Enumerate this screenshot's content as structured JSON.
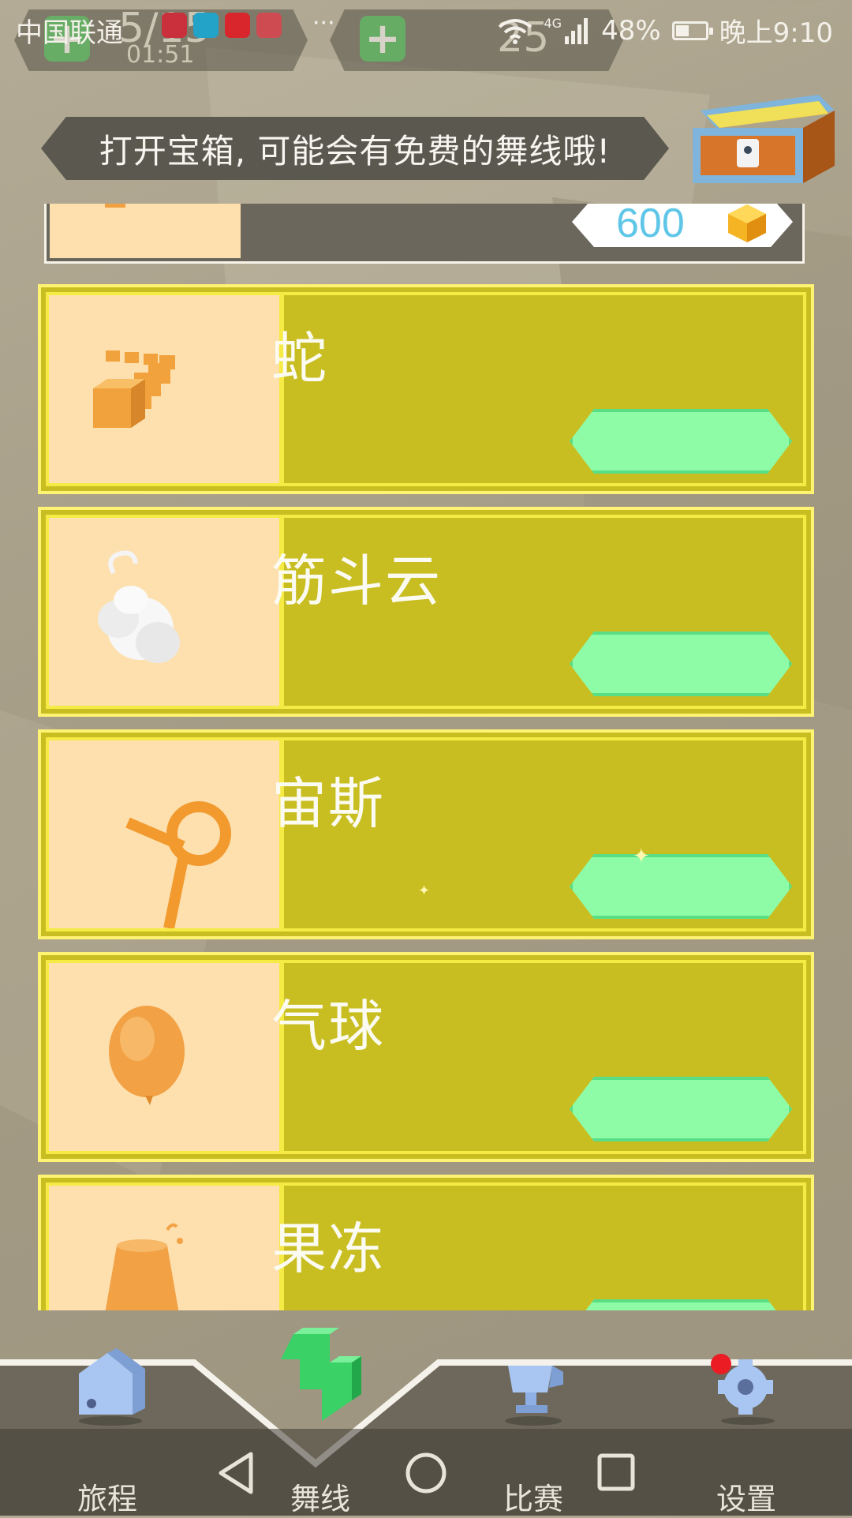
{
  "status_bar": {
    "carrier": "中国联通",
    "network": "4G",
    "battery": "48%",
    "time": "晚上9:10",
    "notification_more": "···"
  },
  "hud": {
    "left_counter": "5/15",
    "timer": "01:51",
    "gems": "25"
  },
  "banner": {
    "text": "打开宝箱, 可能会有免费的舞线哦!"
  },
  "list": {
    "partial_item": {
      "price": "600"
    },
    "items": [
      {
        "name": "蛇"
      },
      {
        "name": "筋斗云"
      },
      {
        "name": "宙斯"
      },
      {
        "name": "气球"
      },
      {
        "name": "果冻"
      }
    ]
  },
  "nav": {
    "items": [
      {
        "label": "旅程",
        "icon": "house-icon"
      },
      {
        "label": "舞线",
        "icon": "dancing-line-icon"
      },
      {
        "label": "比赛",
        "icon": "trophy-icon"
      },
      {
        "label": "设置",
        "icon": "gear-icon"
      }
    ],
    "settings_badge": true
  },
  "colors": {
    "card_bg": "#c9be21",
    "card_border": "#f6ea45",
    "thumb_bg": "#fde0ae",
    "button": "#8efca6",
    "price_text": "#5fc6e8"
  }
}
